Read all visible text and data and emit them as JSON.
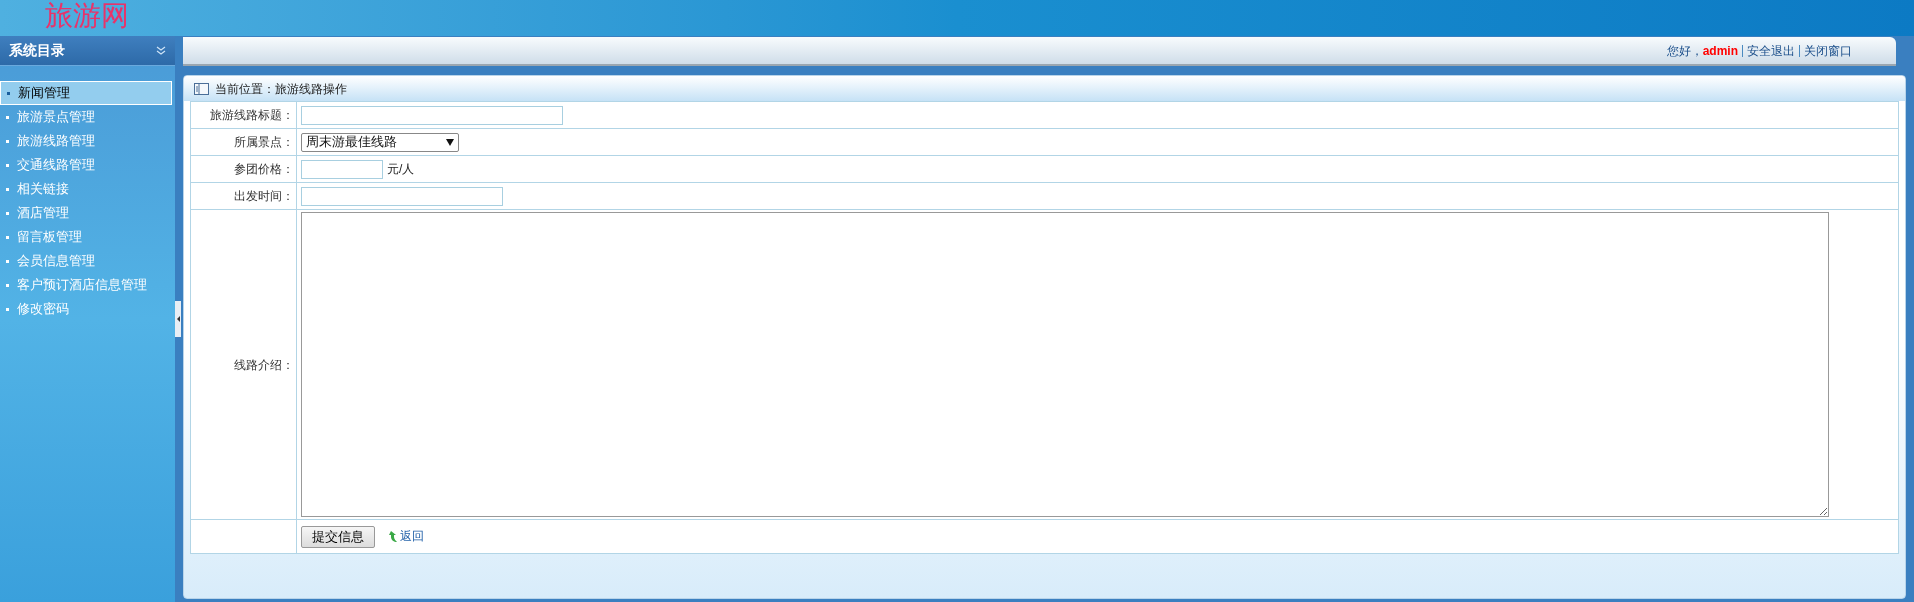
{
  "header": {
    "logo": "旅游网"
  },
  "sidebar": {
    "title": "系统目录",
    "items": [
      {
        "label": "新闻管理",
        "selected": true
      },
      {
        "label": "旅游景点管理",
        "selected": false
      },
      {
        "label": "旅游线路管理",
        "selected": false
      },
      {
        "label": "交通线路管理",
        "selected": false
      },
      {
        "label": "相关链接",
        "selected": false
      },
      {
        "label": "酒店管理",
        "selected": false
      },
      {
        "label": "留言板管理",
        "selected": false
      },
      {
        "label": "会员信息管理",
        "selected": false
      },
      {
        "label": "客户预订酒店信息管理",
        "selected": false
      },
      {
        "label": "修改密码",
        "selected": false
      }
    ]
  },
  "topbar": {
    "greeting": "您好，",
    "user": "admin",
    "links": [
      "安全退出",
      "关闭窗口"
    ]
  },
  "breadcrumb": "当前位置：旅游线路操作",
  "form": {
    "fields": [
      {
        "kind": "text",
        "label": "旅游线路标题："
      },
      {
        "kind": "select",
        "label": "所属景点：",
        "value": "周末游最佳线路"
      },
      {
        "kind": "text",
        "label": "参团价格：",
        "suffix": "元/人"
      },
      {
        "kind": "text",
        "label": "出发时间："
      },
      {
        "kind": "textarea",
        "label": "线路介绍："
      }
    ],
    "submit": "提交信息",
    "back": "返回"
  }
}
